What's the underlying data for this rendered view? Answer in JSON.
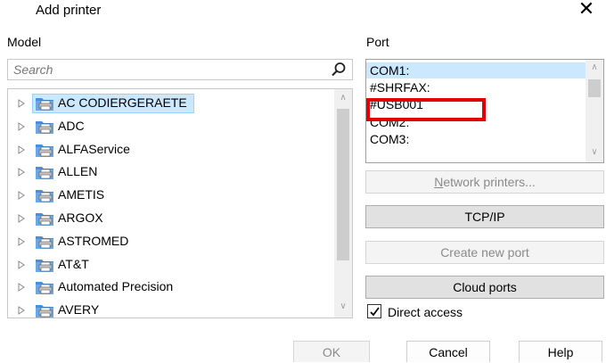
{
  "window": {
    "title": "Add printer",
    "close_glyph": "✕"
  },
  "model": {
    "label": "Model",
    "search_placeholder": "Search",
    "items": [
      {
        "label": "AC CODIERGERAETE",
        "selected": true
      },
      {
        "label": "ADC"
      },
      {
        "label": "ALFAService"
      },
      {
        "label": "ALLEN"
      },
      {
        "label": "AMETIS"
      },
      {
        "label": "ARGOX"
      },
      {
        "label": "ASTROMED"
      },
      {
        "label": "AT&T"
      },
      {
        "label": "Automated Precision"
      },
      {
        "label": "AVERY"
      }
    ]
  },
  "port": {
    "label": "Port",
    "items": [
      {
        "label": "COM1:",
        "selected": true
      },
      {
        "label": "#SHRFAX:"
      },
      {
        "label": "#USB001"
      },
      {
        "label": "COM2:"
      },
      {
        "label": "COM3:"
      }
    ]
  },
  "buttons": {
    "network_printers": "Network printers...",
    "tcpip": "TCP/IP",
    "create_new_port": "Create new port",
    "cloud_ports": "Cloud ports",
    "ok": "OK",
    "cancel": "Cancel",
    "help": "Help"
  },
  "direct_access": {
    "label": "Direct access",
    "checked": true
  },
  "colors": {
    "selection": "#cce8ff",
    "highlight_box": "#e30000",
    "folder_icon": "#4a8fd8"
  },
  "icons": [
    "close-icon",
    "search-icon",
    "printer-folder-icon",
    "expand-triangle-icon",
    "checkmark-icon"
  ]
}
